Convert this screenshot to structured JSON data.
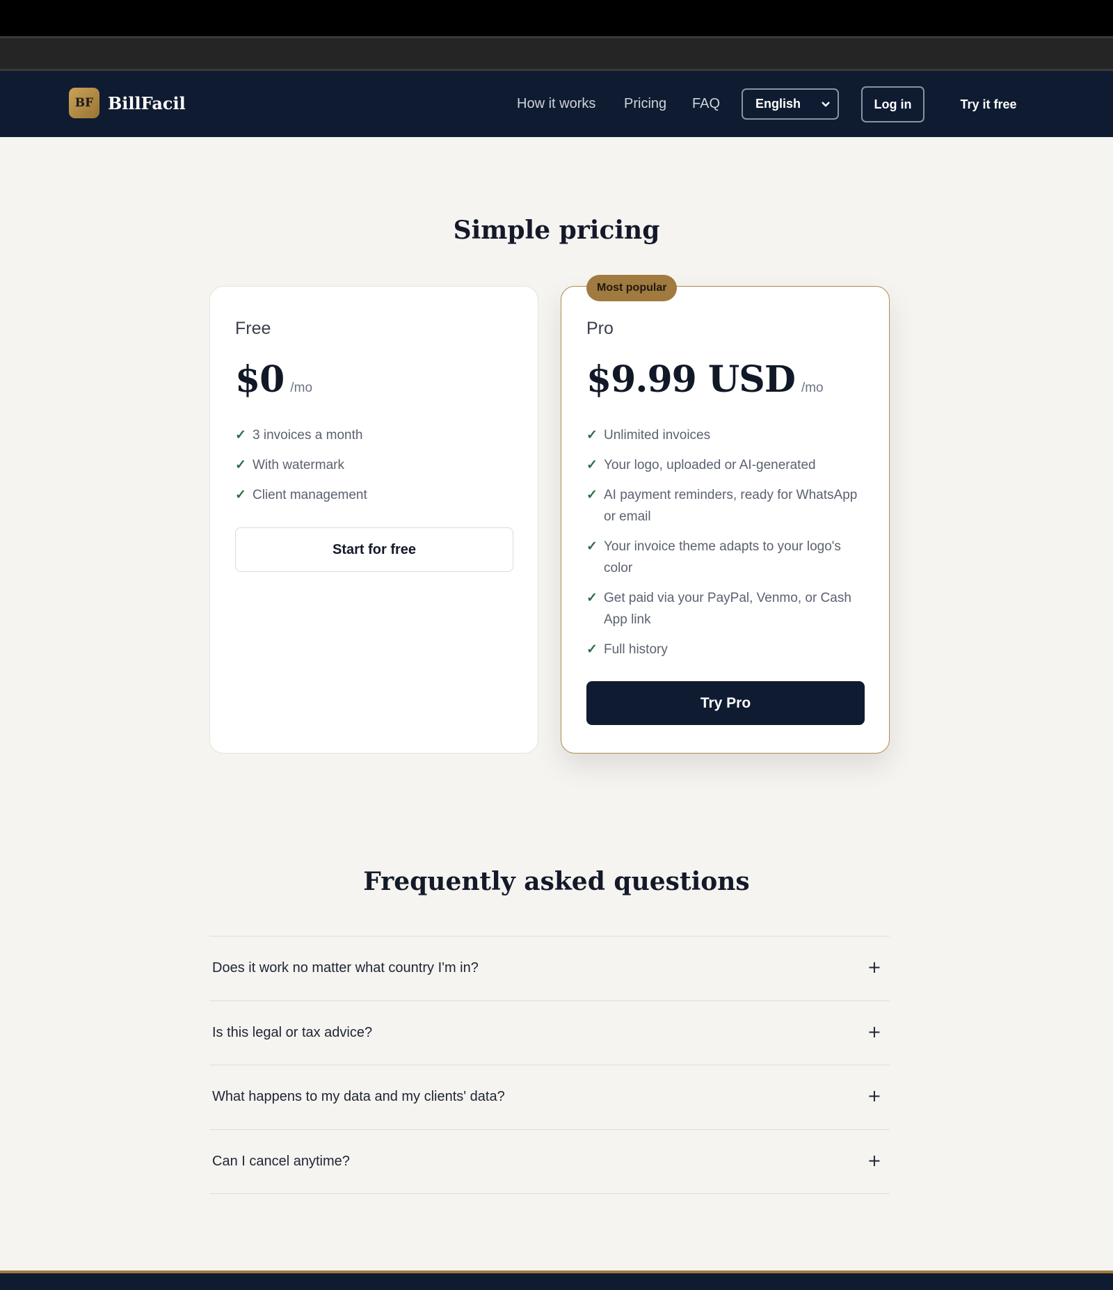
{
  "nav": {
    "logo_mark": "BF",
    "brand": "BillFacil",
    "links": [
      "How it works",
      "Pricing",
      "FAQ"
    ],
    "language": "English",
    "login": "Log in",
    "try_free": "Try it free"
  },
  "pricing": {
    "title": "Simple pricing",
    "free": {
      "name": "Free",
      "price": "$0",
      "period": "/mo",
      "features": [
        "3 invoices a month",
        "With watermark",
        "Client management"
      ],
      "cta": "Start for free"
    },
    "pro": {
      "badge": "Most popular",
      "name": "Pro",
      "price": "$9.99 USD",
      "period": "/mo",
      "features": [
        "Unlimited invoices",
        "Your logo, uploaded or AI-generated",
        "AI payment reminders, ready for WhatsApp or email",
        "Your invoice theme adapts to your logo's color",
        "Get paid via your PayPal, Venmo, or Cash App link",
        "Full history"
      ],
      "cta": "Try Pro"
    }
  },
  "faq": {
    "title": "Frequently asked questions",
    "items": [
      "Does it work no matter what country I'm in?",
      "Is this legal or tax advice?",
      "What happens to my data and my clients' data?",
      "Can I cancel anytime?"
    ]
  },
  "icons": {
    "check": "checkmark-icon",
    "expand": "plus-icon",
    "dropdown": "chevron-down-icon"
  },
  "colors": {
    "navy": "#0f1b30",
    "gold": "#a07a3e",
    "background": "#f5f4f0",
    "check": "#2f6a4a"
  }
}
